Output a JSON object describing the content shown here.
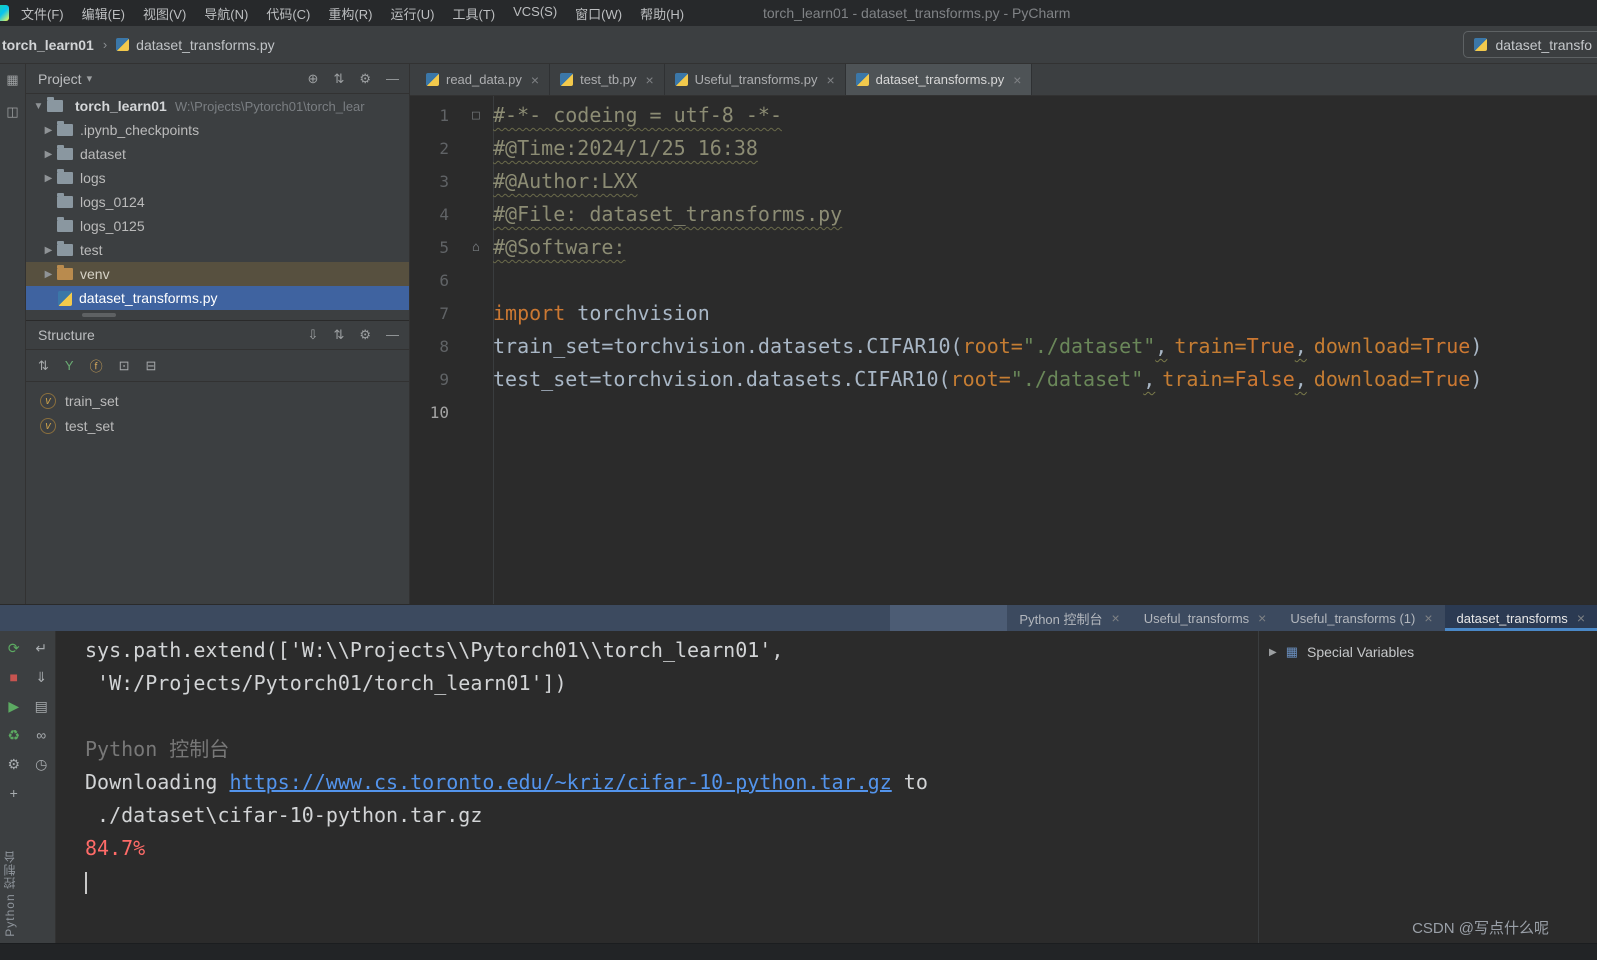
{
  "colors": {
    "accent": "#4a88c7",
    "selection": "#3f63a0",
    "link": "#5394ec",
    "error": "#ff6b68",
    "keyword": "#cc7832",
    "string": "#6a8759",
    "comment": "#8c8c74",
    "param": "#c57d33"
  },
  "title_bar": {
    "menus": [
      "文件(F)",
      "编辑(E)",
      "视图(V)",
      "导航(N)",
      "代码(C)",
      "重构(R)",
      "运行(U)",
      "工具(T)",
      "VCS(S)",
      "窗口(W)",
      "帮助(H)"
    ],
    "title": "torch_learn01 - dataset_transforms.py - PyCharm"
  },
  "breadcrumb": {
    "project": "torch_learn01",
    "separator": "›",
    "file": "dataset_transforms.py",
    "run_config": "dataset_transfo"
  },
  "stripe": {
    "top_icons": [
      {
        "g": "▦",
        "n": "project-tool-icon"
      },
      {
        "g": "◫",
        "n": "bookmarks-tool-icon"
      }
    ],
    "bottom_label": "Python 控制台"
  },
  "project_panel": {
    "header": "Project",
    "header_icons": [
      {
        "g": "⊕",
        "n": "locate-file-icon"
      },
      {
        "g": "⇅",
        "n": "collapse-all-icon"
      },
      {
        "g": "⚙",
        "n": "settings-icon"
      },
      {
        "g": "—",
        "n": "hide-panel-icon"
      }
    ],
    "root": {
      "chevron": "▼",
      "name": "torch_learn01",
      "path": "W:\\Projects\\Pytorch01\\torch_lear"
    },
    "items": [
      {
        "chevron": "▶",
        "icon": "folder",
        "label": ".ipynb_checkpoints"
      },
      {
        "chevron": "▶",
        "icon": "folder",
        "label": "dataset"
      },
      {
        "chevron": "▶",
        "icon": "folder",
        "label": "logs"
      },
      {
        "chevron": "",
        "icon": "folder",
        "label": "logs_0124"
      },
      {
        "chevron": "",
        "icon": "folder",
        "label": "logs_0125"
      },
      {
        "chevron": "▶",
        "icon": "folder",
        "label": "test"
      },
      {
        "chevron": "▶",
        "icon": "folder-excluded",
        "label": "venv",
        "excluded": true
      },
      {
        "chevron": "",
        "icon": "pyfile",
        "label": "dataset_transforms.py",
        "selected": true
      }
    ]
  },
  "structure_panel": {
    "header": "Structure",
    "header_icons": [
      {
        "g": "⇩",
        "n": "expand-all-icon"
      },
      {
        "g": "⇅",
        "n": "collapse-all-icon"
      },
      {
        "g": "⚙",
        "n": "settings-icon"
      },
      {
        "g": "—",
        "n": "hide-panel-icon"
      }
    ],
    "toolbar_icons": [
      {
        "g": "⇅",
        "n": "sort-alphabetically-icon"
      },
      {
        "g": "Y",
        "n": "filter-icon",
        "c": "green"
      },
      {
        "g": "ⓕ",
        "n": "show-fields-icon",
        "c": "orange"
      },
      {
        "g": "⊡",
        "n": "show-inherited-icon"
      },
      {
        "g": "⊟",
        "n": "collapse-nodes-icon"
      }
    ],
    "items": [
      {
        "label": "train_set",
        "icon": "v"
      },
      {
        "label": "test_set",
        "icon": "v"
      }
    ]
  },
  "editor": {
    "tabs": [
      {
        "label": "read_data.py"
      },
      {
        "label": "test_tb.py"
      },
      {
        "label": "Useful_transforms.py"
      },
      {
        "label": "dataset_transforms.py",
        "active": true
      }
    ],
    "close_glyph": "×",
    "lines": [
      {
        "n": 1,
        "gicon": "□",
        "tokens": [
          {
            "t": "#-*- codeing = utf-8 -*-",
            "c": "cm"
          }
        ]
      },
      {
        "n": 2,
        "tokens": [
          {
            "t": "#@Time:2024/1/25 16:38",
            "c": "cm"
          }
        ]
      },
      {
        "n": 3,
        "tokens": [
          {
            "t": "#@Author:LXX",
            "c": "cm"
          }
        ]
      },
      {
        "n": 4,
        "tokens": [
          {
            "t": "#@File: dataset_transforms.py",
            "c": "cm"
          }
        ]
      },
      {
        "n": 5,
        "gicon": "⌂",
        "tokens": [
          {
            "t": "#@Software:",
            "c": "cm"
          }
        ]
      },
      {
        "n": 6,
        "tokens": []
      },
      {
        "n": 7,
        "tokens": [
          {
            "t": "import",
            "c": "kw"
          },
          {
            "t": " torchvision",
            "c": "p"
          }
        ]
      },
      {
        "n": 8,
        "tokens": [
          {
            "t": "train_set=torchvision.datasets.CIFAR10(",
            "c": "p"
          },
          {
            "t": "root=",
            "c": "prm"
          },
          {
            "t": "\"./dataset\"",
            "c": "str"
          },
          {
            "t": ",",
            "c": "wa"
          },
          {
            "t": "train=",
            "c": "prm"
          },
          {
            "t": "True",
            "c": "kw"
          },
          {
            "t": ",",
            "c": "wa"
          },
          {
            "t": "download=",
            "c": "prm"
          },
          {
            "t": "True",
            "c": "kw"
          },
          {
            "t": ")",
            "c": "p"
          }
        ]
      },
      {
        "n": 9,
        "tokens": [
          {
            "t": "test_set=torchvision.datasets.CIFAR10(",
            "c": "p"
          },
          {
            "t": "root=",
            "c": "prm"
          },
          {
            "t": "\"./dataset\"",
            "c": "str"
          },
          {
            "t": ",",
            "c": "wa"
          },
          {
            "t": "train=",
            "c": "prm"
          },
          {
            "t": "False",
            "c": "kw"
          },
          {
            "t": ",",
            "c": "wa"
          },
          {
            "t": "download=",
            "c": "prm"
          },
          {
            "t": "True",
            "c": "kw"
          },
          {
            "t": ")",
            "c": "p"
          }
        ]
      },
      {
        "n": 10,
        "current": true,
        "tokens": []
      }
    ]
  },
  "console": {
    "tabs": [
      {
        "label": "Python 控制台"
      },
      {
        "label": "Useful_transforms"
      },
      {
        "label": "Useful_transforms (1)"
      },
      {
        "label": "dataset_transforms",
        "active": true
      }
    ],
    "close_glyph": "×",
    "toolbar_col1": [
      {
        "g": "⟳",
        "n": "rerun-icon",
        "c": "green"
      },
      {
        "g": "■",
        "n": "stop-icon",
        "c": "red"
      },
      {
        "g": "▶",
        "n": "execute-icon",
        "c": "green"
      },
      {
        "g": "♻",
        "n": "restart-console-icon",
        "c": "green"
      },
      {
        "g": "⚙",
        "n": "settings-icon"
      },
      {
        "g": "+",
        "n": "new-console-icon"
      }
    ],
    "toolbar_col2": [
      {
        "g": "↵",
        "n": "soft-wrap-icon"
      },
      {
        "g": "⇓",
        "n": "scroll-to-end-icon"
      },
      {
        "g": "▤",
        "n": "print-icon"
      },
      {
        "g": "∞",
        "n": "console-prompt-icon"
      },
      {
        "g": "◷",
        "n": "history-icon"
      }
    ],
    "lines": [
      {
        "tokens": [
          {
            "t": "sys.path.extend(['W:\\\\Projects\\\\Pytorch01\\\\torch_learn01',",
            "c": "p"
          }
        ]
      },
      {
        "tokens": [
          {
            "t": " 'W:/Projects/Pytorch01/torch_learn01'])",
            "c": "p"
          }
        ]
      },
      {
        "tokens": []
      },
      {
        "tokens": [
          {
            "t": "Python 控制台",
            "c": "dim"
          }
        ]
      },
      {
        "tokens": [
          {
            "t": "Downloading ",
            "c": "p"
          },
          {
            "t": "https://www.cs.toronto.edu/~kriz/cifar-10-python.tar.gz",
            "c": "link"
          },
          {
            "t": " to",
            "c": "p"
          }
        ]
      },
      {
        "tokens": [
          {
            "t": " ./dataset\\cifar-10-python.tar.gz",
            "c": "p"
          }
        ]
      },
      {
        "tokens": [
          {
            "t": "84.7%",
            "c": "err"
          }
        ]
      },
      {
        "tokens": [
          {
            "t": "",
            "c": "caret"
          }
        ]
      }
    ],
    "special_variables_label": "Special Variables"
  },
  "watermark": "CSDN @写点什么呢"
}
